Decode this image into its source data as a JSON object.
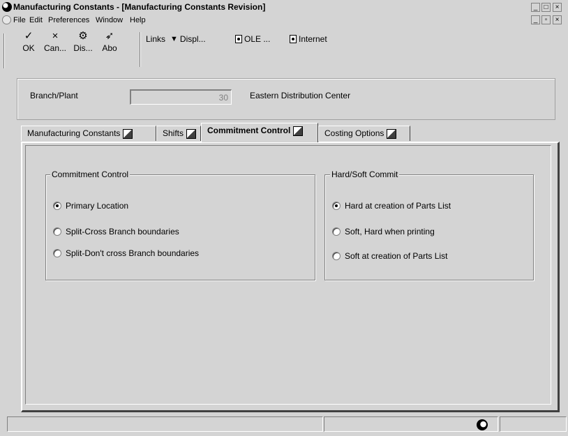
{
  "window": {
    "title": "Manufacturing Constants - [Manufacturing Constants Revision]"
  },
  "menu": [
    "File",
    "Edit",
    "Preferences",
    "Window",
    "Help"
  ],
  "toolbar": {
    "buttons": [
      {
        "glyph": "✓",
        "label": "OK",
        "icon": "checkmark-icon"
      },
      {
        "glyph": "×",
        "label": "Can...",
        "icon": "cancel-icon"
      },
      {
        "glyph": "⚙",
        "label": "Dis...",
        "icon": "display-icon"
      },
      {
        "glyph": "➶",
        "label": "Abo",
        "icon": "about-icon"
      }
    ],
    "links": "Links",
    "displ": "Displ...",
    "ole": "OLE ...",
    "internet": "Internet"
  },
  "header": {
    "branch_label": "Branch/Plant",
    "branch_value": "30",
    "branch_desc": "Eastern Distribution Center"
  },
  "tabs": [
    "Manufacturing Constants",
    "Shifts",
    "Commitment Control",
    "Costing Options"
  ],
  "active_tab": "Commitment Control",
  "commitment": {
    "title": "Commitment Control",
    "options": [
      "Primary Location",
      "Split-Cross Branch boundaries",
      "Split-Don't cross Branch boundaries"
    ],
    "selected": 0
  },
  "hardsoft": {
    "title": "Hard/Soft Commit",
    "options": [
      "Hard at creation of Parts List",
      "Soft, Hard when printing",
      "Soft at creation of Parts List"
    ],
    "selected": 0
  }
}
